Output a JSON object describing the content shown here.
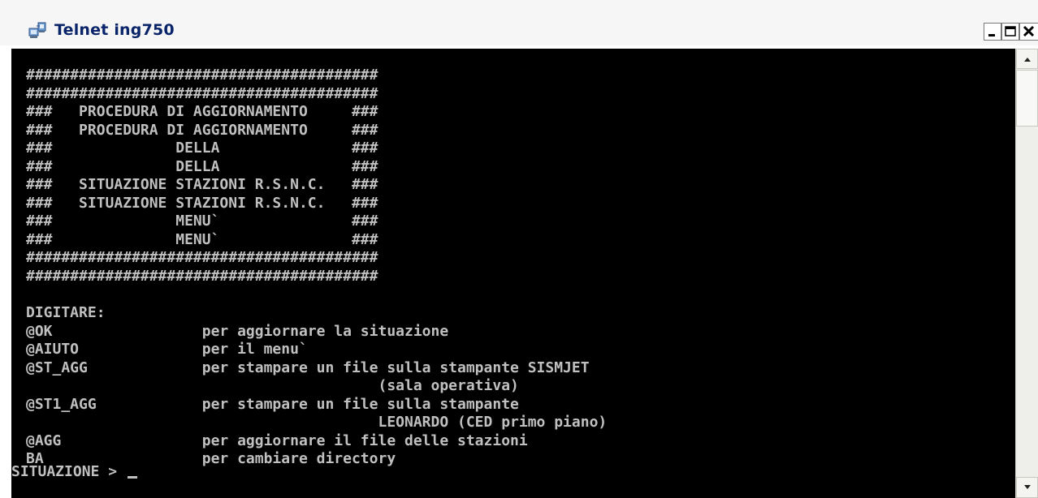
{
  "window": {
    "title": "Telnet ing750",
    "icon": "telnet-app-icon",
    "controls": {
      "minimize": "minimize-icon",
      "maximize": "maximize-icon",
      "close": "close-icon"
    }
  },
  "terminal": {
    "lines": [
      "########################################",
      "########################################",
      "###   PROCEDURA DI AGGIORNAMENTO     ###",
      "###   PROCEDURA DI AGGIORNAMENTO     ###",
      "###              DELLA               ###",
      "###              DELLA               ###",
      "###   SITUAZIONE STAZIONI R.S.N.C.   ###",
      "###   SITUAZIONE STAZIONI R.S.N.C.   ###",
      "###              MENU`               ###",
      "###              MENU`               ###",
      "########################################",
      "########################################",
      "",
      "DIGITARE:",
      "@OK                 per aggiornare la situazione",
      "@AIUTO              per il menu`",
      "@ST_AGG             per stampare un file sulla stampante SISMJET",
      "                                        (sala operativa)",
      "@ST1_AGG            per stampare un file sulla stampante",
      "                                        LEONARDO (CED primo piano)",
      "@AGG                per aggiornare il file delle stazioni",
      "BA                  per cambiare directory"
    ],
    "prompt": "SITUAZIONE > ",
    "colors": {
      "background": "#000000",
      "foreground": "#c0c0c0"
    }
  }
}
